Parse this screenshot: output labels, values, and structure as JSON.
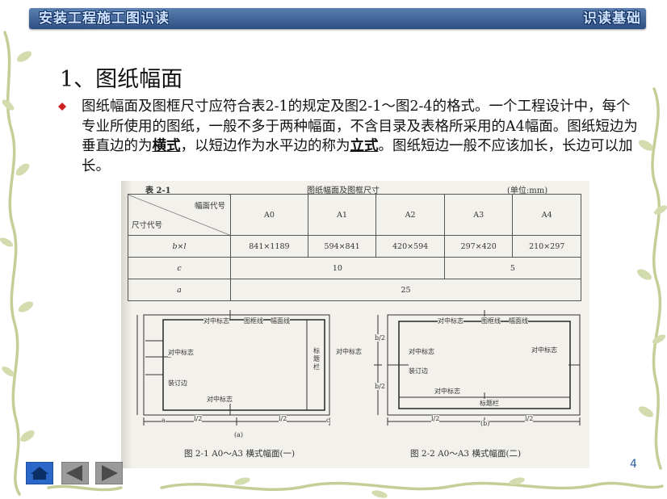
{
  "header": {
    "title": "安装工程施工图识读",
    "section": "识读基础"
  },
  "slide": {
    "heading": "1、图纸幅面",
    "para_part1": "图纸幅面及图框尺寸应符合表2-1的规定及图2-1～图2-4的格式。一个工程设计中，每个专业所使用的图纸，一般不多于两种幅面，不含目录及表格所采用的A4幅面。图纸短边为垂直边的为",
    "em1": "横式",
    "para_part2": "，以短边作为水平边的称为",
    "em2": "立式",
    "para_part3": "。图纸短边一般不应该加长，长边可以加长。"
  },
  "table": {
    "label": "表 2-1",
    "title": "图纸幅面及图框尺寸",
    "unit": "(单位:mm)",
    "diag_top": "幅面代号",
    "diag_bottom": "尺寸代号",
    "columns": [
      "A0",
      "A1",
      "A2",
      "A3",
      "A4"
    ],
    "rows": [
      {
        "label": "b×l",
        "values": [
          "841×1189",
          "594×841",
          "420×594",
          "297×420",
          "210×297"
        ]
      },
      {
        "label": "c",
        "left_value": "10",
        "right_value": "5"
      },
      {
        "label": "a",
        "value": "25"
      }
    ]
  },
  "figure1": {
    "labels": {
      "center_mark_top": "对中标志",
      "frame_line": "图框线",
      "trim_line": "幅面线",
      "center_mark_left": "对中标志",
      "title_block": "标题栏",
      "center_mark_right": "对中标志",
      "binding_edge": "装订边",
      "center_mark_bottom": "对中标志",
      "dim_half_l_1": "l/2",
      "dim_half_l_2": "l/2",
      "sub": "(a)",
      "dim_a": "a",
      "dim_c": "c"
    },
    "caption": "图 2-1   A0～A3 横式幅面(一)"
  },
  "figure2": {
    "labels": {
      "center_mark_top": "对中标志",
      "frame_line": "图框线",
      "trim_line": "幅面线",
      "center_mark_left": "对中标志",
      "center_mark_right": "对中标志",
      "binding_edge": "装订边",
      "center_mark_bottom": "对中标志",
      "title_block": "标题栏",
      "dim_half_l_1": "l/2",
      "dim_half_l_2": "l/2",
      "sub": "(b)",
      "dim_half_b_1": "b/2",
      "dim_half_b_2": "b/2"
    },
    "caption": "图 2-2   A0～A3 横式幅面(二)"
  },
  "nav": {
    "home_icon": "home-icon",
    "prev_icon": "prev-arrow-icon",
    "next_icon": "next-arrow-icon"
  },
  "page_number": "4",
  "colors": {
    "header_bar": "#3d6298",
    "bullet": "#cc1f1f",
    "page_number": "#2f5fa0",
    "vine": "#b9c78a"
  }
}
